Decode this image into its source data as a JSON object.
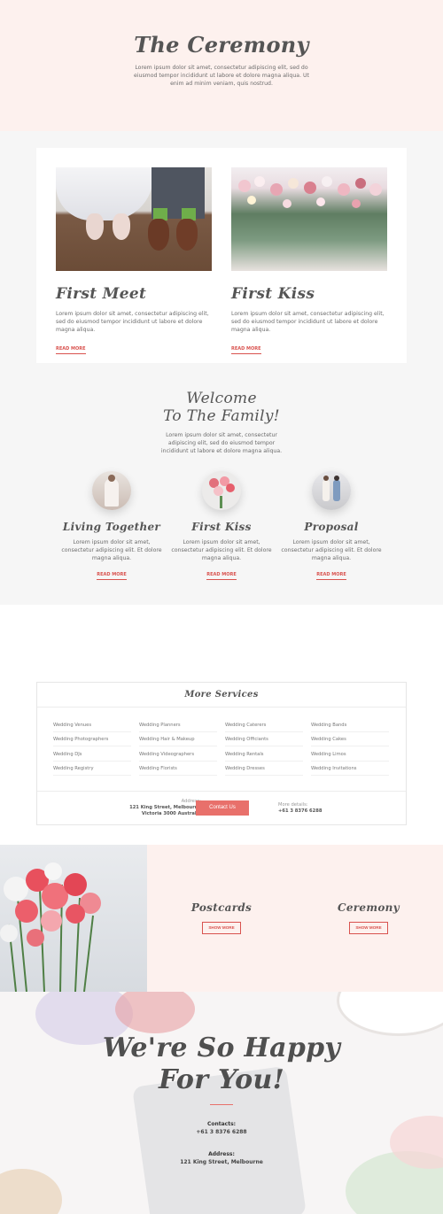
{
  "hero": {
    "title": "The Ceremony",
    "text": "Lorem ipsum dolor sit amet, consectetur adipiscing elit, sed do eiusmod tempor incididunt ut labore et dolore magna aliqua. Ut enim ad minim veniam, quis nostrud."
  },
  "cards": [
    {
      "title": "First Meet",
      "text": "Lorem ipsum dolor sit amet, consectetur adipiscing elit, sed do eiusmod tempor incididunt ut labore et dolore magna aliqua.",
      "link": "READ MORE"
    },
    {
      "title": "First Kiss",
      "text": "Lorem ipsum dolor sit amet, consectetur adipiscing elit, sed do eiusmod tempor incididunt ut labore et dolore magna aliqua.",
      "link": "READ MORE"
    }
  ],
  "welcome": {
    "line1": "Welcome",
    "line2": "To The Family!",
    "text": "Lorem ipsum dolor sit amet, consectetur adipiscing elit, sed do eiusmod tempor incididunt ut labore et dolore magna aliqua."
  },
  "features": [
    {
      "title": "Living Together",
      "text": "Lorem ipsum dolor sit amet, consectetur adipiscing elit. Et dolore magna aliqua.",
      "link": "READ MORE"
    },
    {
      "title": "First Kiss",
      "text": "Lorem ipsum dolor sit amet, consectetur adipiscing elit. Et dolore magna aliqua.",
      "link": "READ MORE"
    },
    {
      "title": "Proposal",
      "text": "Lorem ipsum dolor sit amet, consectetur adipiscing elit. Et dolore magna aliqua.",
      "link": "READ MORE"
    }
  ],
  "services": {
    "title": "More Services",
    "items": [
      "Wedding Venues",
      "Wedding Planners",
      "Wedding Caterers",
      "Wedding Bands",
      "Wedding Photographers",
      "Wedding Hair & Makeup",
      "Wedding Officiants",
      "Wedding Cakes",
      "Wedding DJs",
      "Wedding Videographers",
      "Wedding Rentals",
      "Wedding Limos",
      "Wedding Registry",
      "Wedding Florists",
      "Wedding Dresses",
      "Wedding Invitations"
    ],
    "address_label": "Address:",
    "address_line1": "121 King Street, Melbourne",
    "address_line2": "Victoria 3000 Australia",
    "contact_button": "Contact Us",
    "more_label": "More details:",
    "more_value": "+61 3 8376 6288"
  },
  "split": {
    "left_title": "Postcards",
    "left_button": "SHOW MORE",
    "right_title": "Ceremony",
    "right_button": "SHOW MORE"
  },
  "footer": {
    "line1": "We're So Happy",
    "line2": "For You!",
    "contacts_label": "Contacts:",
    "contacts_value": "+61 3 8376 6288",
    "address_label": "Address:",
    "address_value": "121 King Street, Melbourne"
  },
  "colors": {
    "accent": "#e8706b",
    "blush": "#fdf1ee",
    "gray_bg": "#f6f6f6"
  }
}
